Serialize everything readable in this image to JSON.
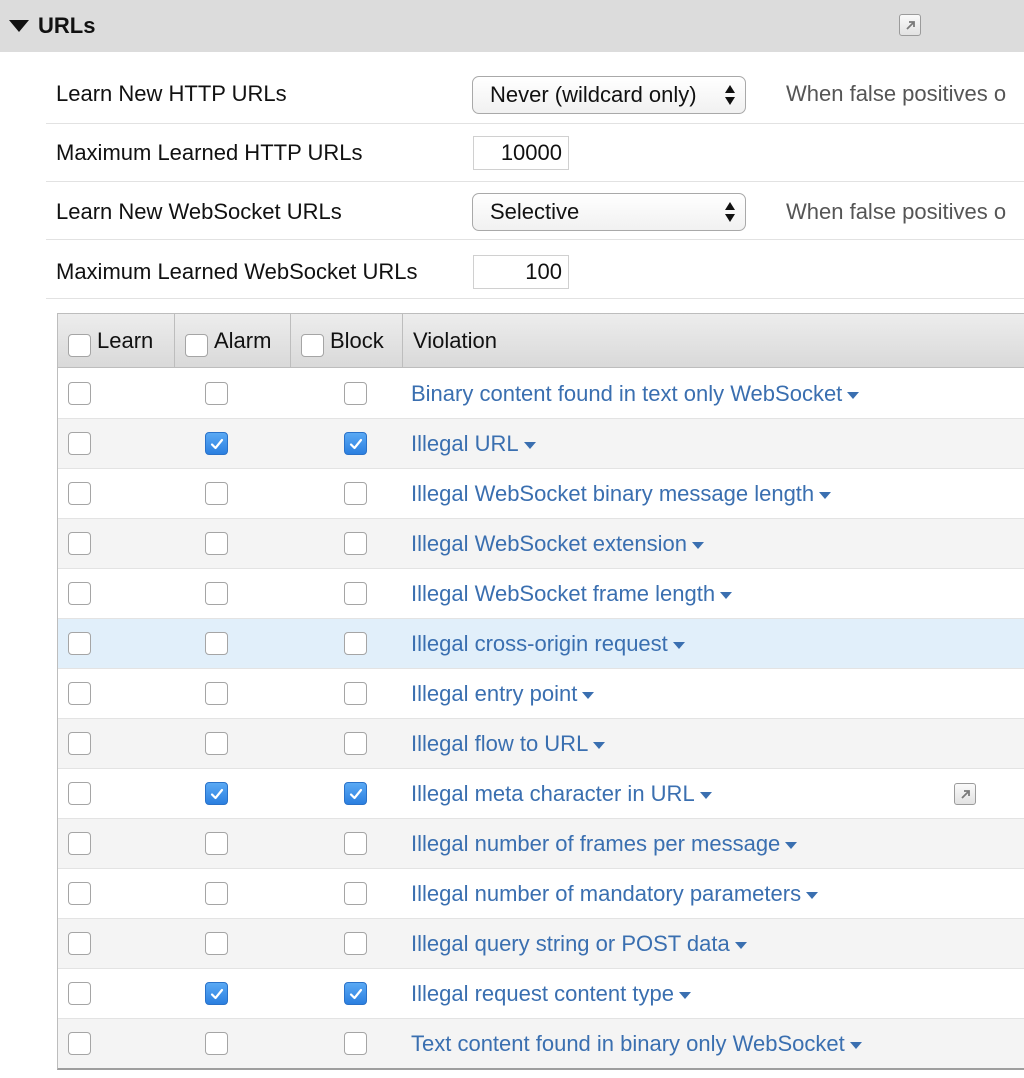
{
  "section": {
    "title": "URLs",
    "popout_icon": "popout-icon"
  },
  "settings": {
    "learn_http": {
      "label": "Learn New HTTP URLs",
      "value": "Never (wildcard only)",
      "hint": "When false positives o"
    },
    "max_http": {
      "label": "Maximum Learned HTTP URLs",
      "value": "10000"
    },
    "learn_ws": {
      "label": "Learn New WebSocket URLs",
      "value": "Selective",
      "hint": "When false positives o"
    },
    "max_ws": {
      "label": "Maximum Learned WebSocket URLs",
      "value": "100"
    }
  },
  "table": {
    "headers": {
      "learn": "Learn",
      "alarm": "Alarm",
      "block": "Block",
      "violation": "Violation"
    },
    "rows": [
      {
        "violation": "Binary content found in text only WebSocket",
        "learn": false,
        "alarm": false,
        "block": false
      },
      {
        "violation": "Illegal URL",
        "learn": false,
        "alarm": true,
        "block": true
      },
      {
        "violation": "Illegal WebSocket binary message length",
        "learn": false,
        "alarm": false,
        "block": false
      },
      {
        "violation": "Illegal WebSocket extension",
        "learn": false,
        "alarm": false,
        "block": false
      },
      {
        "violation": "Illegal WebSocket frame length",
        "learn": false,
        "alarm": false,
        "block": false
      },
      {
        "violation": "Illegal cross-origin request",
        "learn": false,
        "alarm": false,
        "block": false,
        "highlighted": true
      },
      {
        "violation": "Illegal entry point",
        "learn": false,
        "alarm": false,
        "block": false
      },
      {
        "violation": "Illegal flow to URL",
        "learn": false,
        "alarm": false,
        "block": false
      },
      {
        "violation": "Illegal meta character in URL",
        "learn": false,
        "alarm": true,
        "block": true,
        "has_popout": true
      },
      {
        "violation": "Illegal number of frames per message",
        "learn": false,
        "alarm": false,
        "block": false
      },
      {
        "violation": "Illegal number of mandatory parameters",
        "learn": false,
        "alarm": false,
        "block": false
      },
      {
        "violation": "Illegal query string or POST data",
        "learn": false,
        "alarm": false,
        "block": false
      },
      {
        "violation": "Illegal request content type",
        "learn": false,
        "alarm": true,
        "block": true
      },
      {
        "violation": "Text content found in binary only WebSocket",
        "learn": false,
        "alarm": false,
        "block": false
      }
    ]
  },
  "colors": {
    "link": "#3a6fb0",
    "checked": "#2b7fe0",
    "highlight_row": "#e1effa",
    "header_bg": "#dcdcdc"
  }
}
